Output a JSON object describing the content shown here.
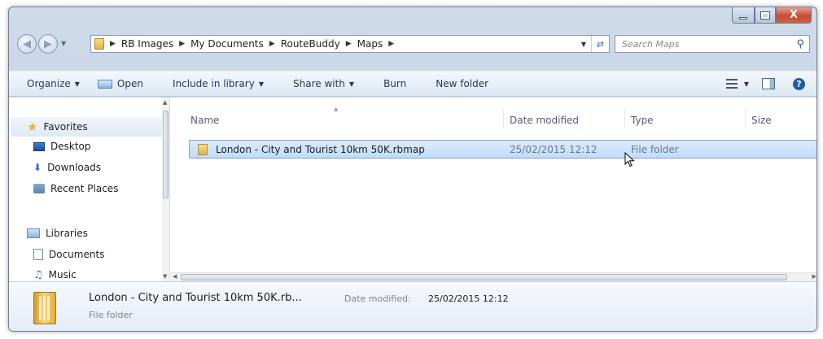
{
  "window": {
    "close_glyph": "X"
  },
  "address_bar": {
    "crumbs": [
      "RB Images",
      "My Documents",
      "RouteBuddy",
      "Maps"
    ]
  },
  "search": {
    "placeholder": "Search Maps"
  },
  "toolbar": {
    "organize": "Organize",
    "open": "Open",
    "include_in_library": "Include in library",
    "share_with": "Share with",
    "burn": "Burn",
    "new_folder": "New folder",
    "help_glyph": "?"
  },
  "nav_pane": {
    "favorites": "Favorites",
    "desktop": "Desktop",
    "downloads": "Downloads",
    "recent_places": "Recent Places",
    "libraries": "Libraries",
    "documents": "Documents",
    "music": "Music"
  },
  "columns": {
    "name": "Name",
    "date_modified": "Date modified",
    "type": "Type",
    "size": "Size"
  },
  "files": [
    {
      "name": "London - City and Tourist 10km 50K.rbmap",
      "date_modified": "25/02/2015 12:12",
      "type": "File folder",
      "selected": true
    }
  ],
  "details_pane": {
    "title": "London - City and Tourist 10km 50K.rb...",
    "date_label": "Date modified:",
    "date_value": "25/02/2015 12:12",
    "type": "File folder"
  },
  "colors": {
    "selection": "#c1dcfc",
    "toolbar_text": "#1e3a5e",
    "close_button": "#c84a32"
  }
}
